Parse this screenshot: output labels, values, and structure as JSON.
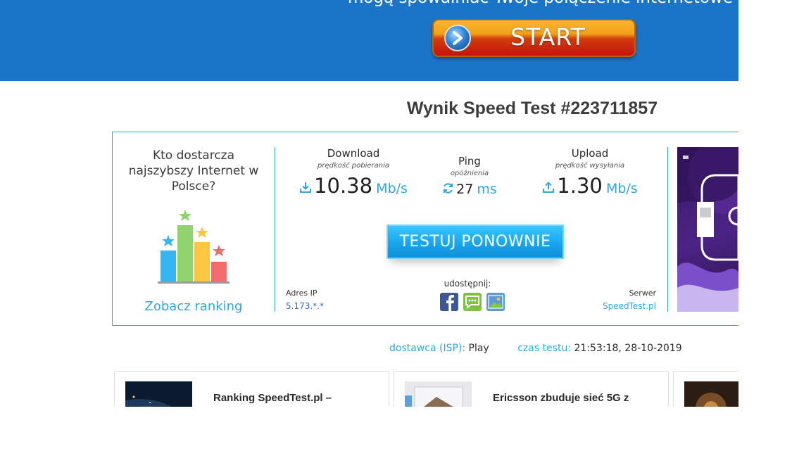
{
  "banner": {
    "text": "mogą spowalniać Twoje połączenie internetowe",
    "start_label": "START"
  },
  "page_title": "Wynik Speed Test #223711857",
  "ranking": {
    "question": "Kto dostarcza najszybszy Internet w Polsce?",
    "link": "Zobacz ranking"
  },
  "download": {
    "name": "Download",
    "sub": "prędkość pobierania",
    "value": "10.38",
    "unit": "Mb/s"
  },
  "ping": {
    "name": "Ping",
    "sub": "opóźnienia",
    "value": "27",
    "unit": "ms"
  },
  "upload": {
    "name": "Upload",
    "sub": "prędkość wysyłania",
    "value": "1.30",
    "unit": "Mb/s"
  },
  "retest_label": "TESTUJ PONOWNIE",
  "ip": {
    "label": "Adres IP",
    "value": "5.173.*.*"
  },
  "share": {
    "label": "udostępnij:"
  },
  "server": {
    "label": "Serwer",
    "value": "SpeedTest.pl"
  },
  "isp": {
    "label": "dostawca (ISP):",
    "value": "Play"
  },
  "test_time": {
    "label": "czas testu:",
    "value": "21:53:18, 28-10-2019"
  },
  "articles": [
    {
      "title": "Ranking SpeedTest.pl –"
    },
    {
      "title": "Ericsson zbuduje sieć 5G z"
    }
  ],
  "colors": {
    "banner": "#1a75c9",
    "accent": "#2ea7e0",
    "retest": "#1ba9f0",
    "border": "#2ba8d9"
  }
}
